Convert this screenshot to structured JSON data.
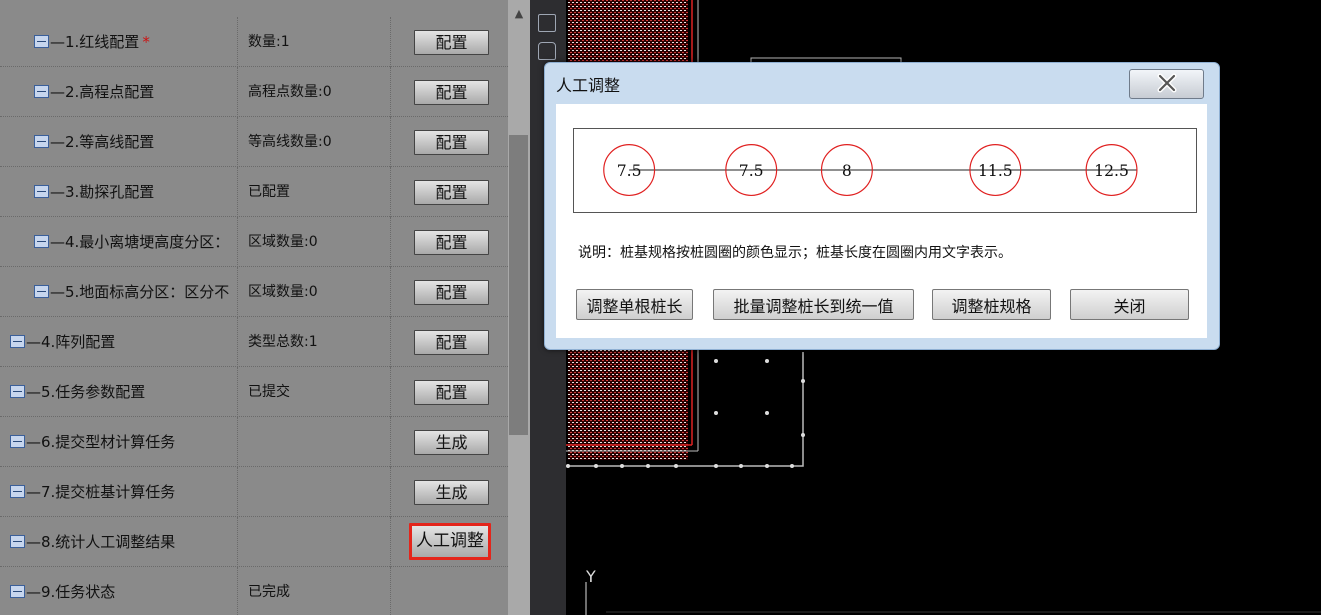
{
  "tree": {
    "rows": [
      {
        "name": "1.红线配置",
        "dash": "—",
        "required": "*",
        "status": "数量:1",
        "action": "配置",
        "level": 2
      },
      {
        "name": "2.高程点配置",
        "dash": "—",
        "required": "",
        "status": "高程点数量:0",
        "action": "配置",
        "level": 2
      },
      {
        "name": "2.等高线配置",
        "dash": "—",
        "required": "",
        "status": "等高线数量:0",
        "action": "配置",
        "level": 2
      },
      {
        "name": "3.勘探孔配置",
        "dash": "—",
        "required": "",
        "status": "已配置",
        "action": "配置",
        "level": 2
      },
      {
        "name": "4.最小离塘埂高度分区：",
        "dash": "—",
        "required": "",
        "status": "区域数量:0",
        "action": "配置",
        "level": 2
      },
      {
        "name": "5.地面标高分区：区分不",
        "dash": "—",
        "required": "",
        "status": "区域数量:0",
        "action": "配置",
        "level": 2
      },
      {
        "name": "4.阵列配置",
        "dash": "—",
        "required": "",
        "status": "类型总数:1",
        "action": "配置",
        "level": 1
      },
      {
        "name": "5.任务参数配置",
        "dash": "—",
        "required": "",
        "status": "已提交",
        "action": "配置",
        "level": 1
      },
      {
        "name": "6.提交型材计算任务",
        "dash": "—",
        "required": "",
        "status": "",
        "action": "生成",
        "level": 1
      },
      {
        "name": "7.提交桩基计算任务",
        "dash": "—",
        "required": "",
        "status": "",
        "action": "生成",
        "level": 1
      },
      {
        "name": "8.统计人工调整结果",
        "dash": "—",
        "required": "",
        "status": "",
        "action": "人工调整",
        "level": 1,
        "highlight": true
      },
      {
        "name": "9.任务状态",
        "dash": "—",
        "required": "",
        "status": "已完成",
        "action": "",
        "level": 1
      }
    ]
  },
  "dialog": {
    "title": "人工调整",
    "close_icon": "close-x-icon",
    "piles": [
      {
        "label": "7.5"
      },
      {
        "label": "7.5"
      },
      {
        "label": "8"
      },
      {
        "label": "11.5"
      },
      {
        "label": "12.5"
      }
    ],
    "pile_color": "#e02020",
    "legend": "说明：桩基规格按桩圆圈的颜色显示；桩基长度在圆圈内用文字表示。",
    "buttons": {
      "adjust_single": "调整单根桩长",
      "batch_adjust": "批量调整桩长到统一值",
      "adjust_spec": "调整桩规格",
      "close": "关闭"
    }
  },
  "cad": {
    "axis_label": "Y",
    "highlight_color": "#e4251b"
  }
}
